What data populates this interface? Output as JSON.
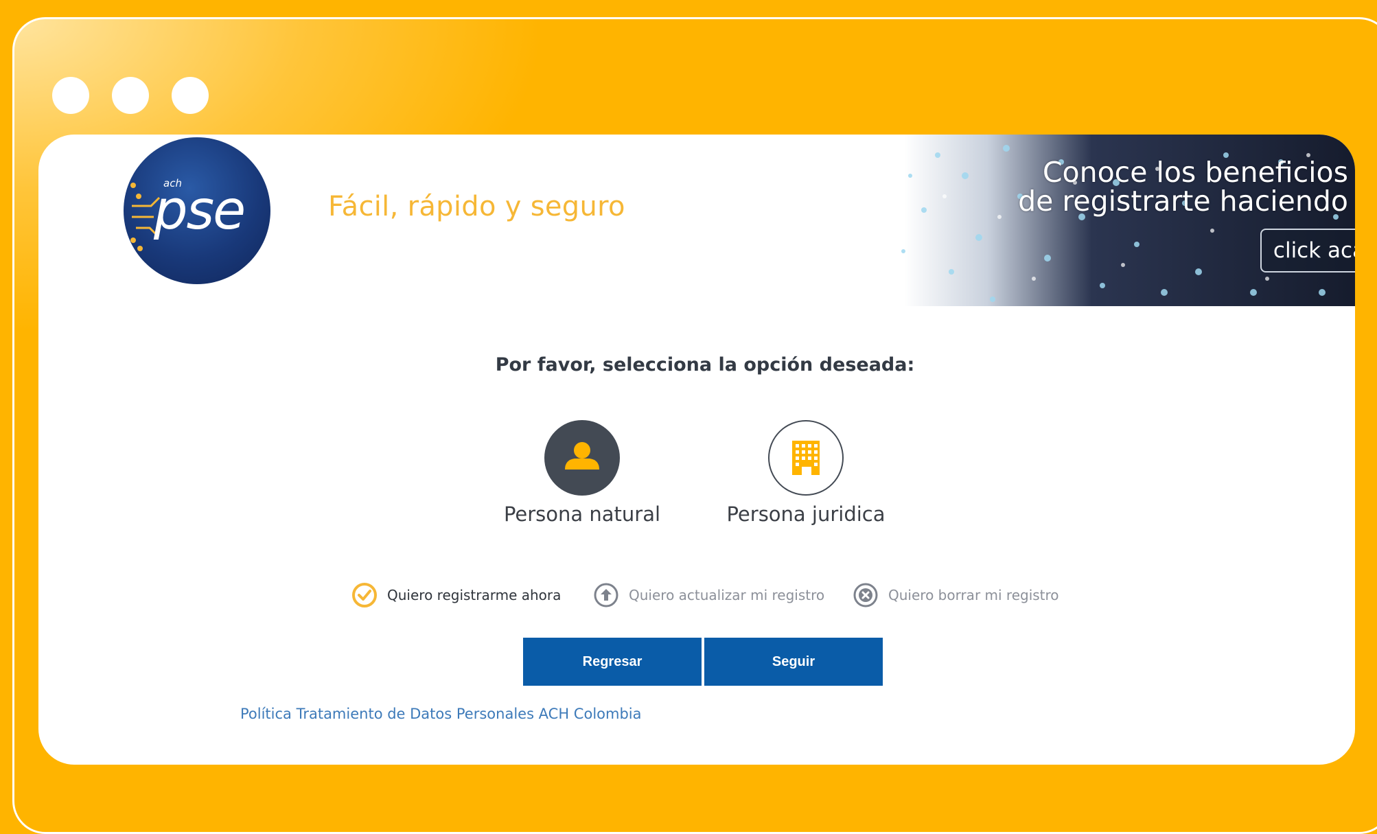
{
  "window": {
    "controls": [
      "dot",
      "dot",
      "dot"
    ]
  },
  "brand": {
    "logo_small_text": "ach",
    "logo_text": "pse",
    "tagline": "Fácil, rápido y seguro"
  },
  "banner": {
    "line1": "Conoce los beneficios",
    "line2": "de registrarte haciendo",
    "button": "click acá"
  },
  "selection": {
    "prompt": "Por favor, selecciona la opción deseada:",
    "options": [
      {
        "label": "Persona natural",
        "icon": "person-icon",
        "selected": true
      },
      {
        "label": "Persona juridica",
        "icon": "building-icon",
        "selected": false
      }
    ]
  },
  "actions": [
    {
      "label": "Quiero registrarme ahora",
      "icon": "check-circle-icon",
      "selected": true
    },
    {
      "label": "Quiero actualizar mi registro",
      "icon": "arrow-up-circle-icon",
      "selected": false
    },
    {
      "label": "Quiero borrar mi registro",
      "icon": "x-circle-icon",
      "selected": false
    }
  ],
  "buttons": {
    "back": "Regresar",
    "next": "Seguir"
  },
  "footer": {
    "policy_link": "Política Tratamiento de Datos Personales ACH Colombia"
  },
  "colors": {
    "background": "#FFB400",
    "primary_button": "#0A5CA8",
    "accent": "#F6B736"
  }
}
